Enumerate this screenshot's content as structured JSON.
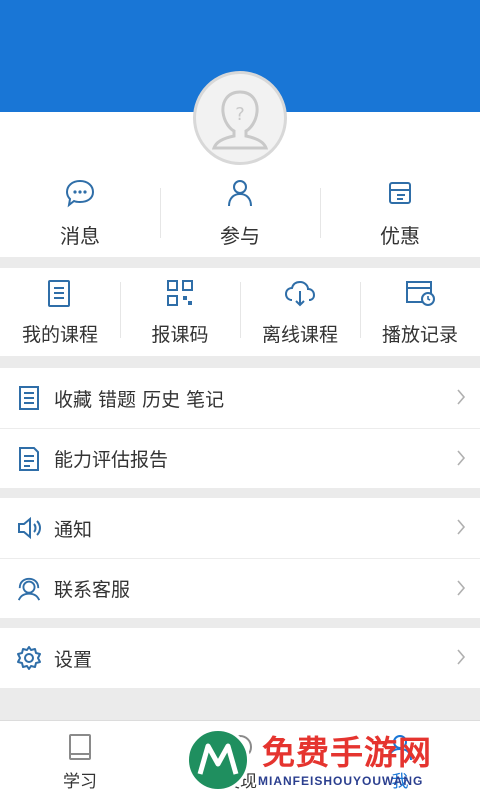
{
  "header": {
    "color": "#1976d6"
  },
  "avatar": {
    "icon": "user-placeholder-icon"
  },
  "top_actions": [
    {
      "label": "消息",
      "icon": "chat-bubble-icon"
    },
    {
      "label": "参与",
      "icon": "person-icon"
    },
    {
      "label": "优惠",
      "icon": "ticket-icon"
    }
  ],
  "course_actions": [
    {
      "label": "我的课程",
      "icon": "course-list-icon"
    },
    {
      "label": "报课码",
      "icon": "qr-code-icon"
    },
    {
      "label": "离线课程",
      "icon": "cloud-download-icon"
    },
    {
      "label": "播放记录",
      "icon": "video-history-icon"
    }
  ],
  "list_group1": [
    {
      "label": "收藏 错题 历史 笔记",
      "icon": "notebook-icon"
    },
    {
      "label": "能力评估报告",
      "icon": "report-icon"
    }
  ],
  "list_group2": [
    {
      "label": "通知",
      "icon": "speaker-icon"
    },
    {
      "label": "联系客服",
      "icon": "headset-icon"
    }
  ],
  "list_group3": [
    {
      "label": "设置",
      "icon": "gear-icon"
    }
  ],
  "tabbar": [
    {
      "label": "学习",
      "icon": "book-icon"
    },
    {
      "label": "发现",
      "icon": "compass-icon"
    },
    {
      "label": "我",
      "icon": "profile-icon",
      "active": true
    }
  ],
  "watermark": {
    "title": "免费手游网",
    "subtitle": "MIANFEISHOUYOUWANG"
  },
  "colors": {
    "accent": "#1976d6",
    "icon": "#2f6ea8"
  }
}
